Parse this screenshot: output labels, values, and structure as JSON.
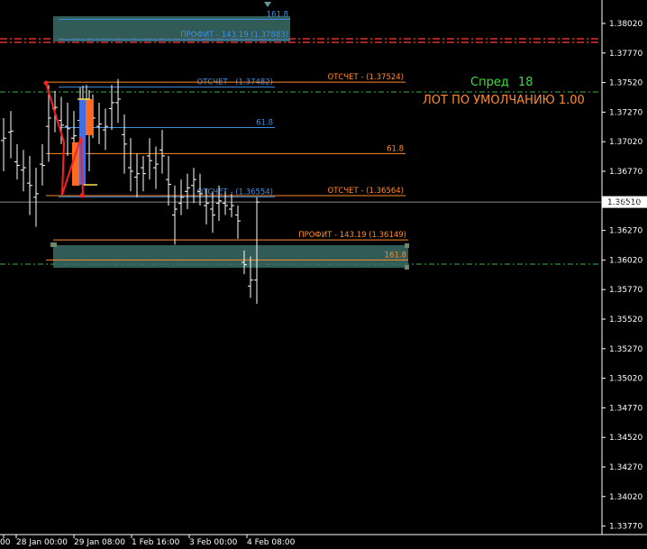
{
  "chart_data": {
    "type": "candlestick",
    "price_axis": {
      "ticks": [
        "1.38020",
        "1.37770",
        "1.37520",
        "1.37270",
        "1.37020",
        "1.36770",
        "1.36520",
        "1.36270",
        "1.36020",
        "1.35770",
        "1.35520",
        "1.35270",
        "1.35020",
        "1.34770",
        "1.34520",
        "1.34270",
        "1.34020",
        "1.33770"
      ],
      "current_price": "1.36510",
      "ylim": [
        1.3363,
        1.3866
      ]
    },
    "time_axis": {
      "labels": [
        "00",
        "28 Jan 00:00",
        "29 Jan 08:00",
        "1 Feb 16:00",
        "3 Feb 00:00",
        "4 Feb 08:00"
      ]
    },
    "info": {
      "spread_label": "Спред",
      "spread_value": "18",
      "default_lot": "ЛОТ ПО УМОЛЧАНИЮ 1.00"
    },
    "levels": [
      {
        "id": "blue-161",
        "label": "161.8",
        "price": 1.38055,
        "color": "#3f8fe0"
      },
      {
        "id": "blue-profit",
        "label": "ПРОФИТ - 143.19 (1.37883)",
        "price": 1.37883,
        "color": "#3f8fe0"
      },
      {
        "id": "blue-retrace-top",
        "label": "ОТСЧЕТ - (1.37482)",
        "price": 1.37482,
        "color": "#3f8fe0"
      },
      {
        "id": "blue-61",
        "label": "61.8",
        "price": 1.3714,
        "color": "#3f8fe0"
      },
      {
        "id": "blue-retrace-bottom",
        "label": "ОТСЧЕТ - (1.36554)",
        "price": 1.36554,
        "color": "#3f8fe0"
      },
      {
        "id": "orange-retrace-top",
        "label": "ОТСЧЕТ - (1.37524)",
        "price": 1.37524,
        "color": "#ff8c2a"
      },
      {
        "id": "orange-61",
        "label": "61.8",
        "price": 1.3692,
        "color": "#ff8c2a"
      },
      {
        "id": "orange-retrace-bottom",
        "label": "ОТСЧЕТ - (1.36564)",
        "price": 1.36564,
        "color": "#ff8c2a"
      },
      {
        "id": "orange-profit",
        "label": "ПРОФИТ - 143.19 (1.36149)",
        "price": 1.3619,
        "color": "#ff8c2a"
      },
      {
        "id": "orange-161",
        "label": "161.8",
        "price": 1.3602,
        "color": "#ff8c2a"
      }
    ],
    "candles": [
      {
        "x": 4,
        "h": 1.3722,
        "l": 1.3677,
        "o": 1.3703,
        "c": 1.3705
      },
      {
        "x": 12,
        "h": 1.3728,
        "l": 1.3688,
        "o": 1.371,
        "c": 1.3711
      },
      {
        "x": 19,
        "h": 1.37,
        "l": 1.367,
        "o": 1.3685,
        "c": 1.3682
      },
      {
        "x": 26,
        "h": 1.3695,
        "l": 1.366,
        "o": 1.3678,
        "c": 1.368
      },
      {
        "x": 33,
        "h": 1.369,
        "l": 1.364,
        "o": 1.3667,
        "c": 1.3665
      },
      {
        "x": 40,
        "h": 1.368,
        "l": 1.363,
        "o": 1.3655,
        "c": 1.3658
      },
      {
        "x": 47,
        "h": 1.37,
        "l": 1.3665,
        "o": 1.3683,
        "c": 1.3682
      },
      {
        "x": 54,
        "h": 1.375,
        "l": 1.3685,
        "o": 1.3715,
        "c": 1.3722
      },
      {
        "x": 61,
        "h": 1.3745,
        "l": 1.371,
        "o": 1.373,
        "c": 1.3731
      },
      {
        "x": 68,
        "h": 1.374,
        "l": 1.37,
        "o": 1.372,
        "c": 1.3716
      },
      {
        "x": 75,
        "h": 1.3735,
        "l": 1.369,
        "o": 1.3715,
        "c": 1.3713
      },
      {
        "x": 82,
        "h": 1.3728,
        "l": 1.3688,
        "o": 1.3705,
        "c": 1.3707
      },
      {
        "x": 89,
        "h": 1.3748,
        "l": 1.37,
        "o": 1.372,
        "c": 1.3716
      },
      {
        "x": 96,
        "h": 1.375,
        "l": 1.371,
        "o": 1.3735,
        "c": 1.3733
      },
      {
        "x": 103,
        "h": 1.3742,
        "l": 1.3705,
        "o": 1.372,
        "c": 1.3722
      },
      {
        "x": 110,
        "h": 1.3735,
        "l": 1.37,
        "o": 1.3715,
        "c": 1.3717
      },
      {
        "x": 117,
        "h": 1.373,
        "l": 1.3695,
        "o": 1.3712,
        "c": 1.3715
      },
      {
        "x": 124,
        "h": 1.375,
        "l": 1.3712,
        "o": 1.373,
        "c": 1.3735
      },
      {
        "x": 131,
        "h": 1.3755,
        "l": 1.3718,
        "o": 1.3735,
        "c": 1.3738
      },
      {
        "x": 138,
        "h": 1.3725,
        "l": 1.3675,
        "o": 1.3708,
        "c": 1.37
      },
      {
        "x": 145,
        "h": 1.3705,
        "l": 1.366,
        "o": 1.368,
        "c": 1.3677
      },
      {
        "x": 152,
        "h": 1.3692,
        "l": 1.3655,
        "o": 1.3672,
        "c": 1.3675
      },
      {
        "x": 159,
        "h": 1.369,
        "l": 1.366,
        "o": 1.368,
        "c": 1.3675
      },
      {
        "x": 166,
        "h": 1.3705,
        "l": 1.367,
        "o": 1.369,
        "c": 1.3686
      },
      {
        "x": 173,
        "h": 1.3698,
        "l": 1.3662,
        "o": 1.368,
        "c": 1.3683
      },
      {
        "x": 180,
        "h": 1.3712,
        "l": 1.3675,
        "o": 1.3695,
        "c": 1.369
      },
      {
        "x": 187,
        "h": 1.369,
        "l": 1.3648,
        "o": 1.367,
        "c": 1.3666
      },
      {
        "x": 194,
        "h": 1.3665,
        "l": 1.3615,
        "o": 1.364,
        "c": 1.3645
      },
      {
        "x": 201,
        "h": 1.367,
        "l": 1.364,
        "o": 1.365,
        "c": 1.3655
      },
      {
        "x": 208,
        "h": 1.3675,
        "l": 1.3645,
        "o": 1.366,
        "c": 1.3663
      },
      {
        "x": 215,
        "h": 1.368,
        "l": 1.365,
        "o": 1.3665,
        "c": 1.367
      },
      {
        "x": 222,
        "h": 1.3675,
        "l": 1.3648,
        "o": 1.366,
        "c": 1.3658
      },
      {
        "x": 229,
        "h": 1.3662,
        "l": 1.3632,
        "o": 1.3648,
        "c": 1.365
      },
      {
        "x": 236,
        "h": 1.366,
        "l": 1.3625,
        "o": 1.3645,
        "c": 1.364
      },
      {
        "x": 243,
        "h": 1.3665,
        "l": 1.3635,
        "o": 1.365,
        "c": 1.3652
      },
      {
        "x": 250,
        "h": 1.366,
        "l": 1.364,
        "o": 1.365,
        "c": 1.3648
      },
      {
        "x": 257,
        "h": 1.3658,
        "l": 1.3638,
        "o": 1.3645,
        "c": 1.3648
      },
      {
        "x": 264,
        "h": 1.3648,
        "l": 1.362,
        "o": 1.364,
        "c": 1.3635
      },
      {
        "x": 271,
        "h": 1.361,
        "l": 1.359,
        "o": 1.36,
        "c": 1.3598
      },
      {
        "x": 278,
        "h": 1.3605,
        "l": 1.357,
        "o": 1.358,
        "c": 1.3585
      },
      {
        "x": 285,
        "h": 1.3655,
        "l": 1.3565,
        "o": 1.3585,
        "c": 1.3651
      }
    ]
  }
}
